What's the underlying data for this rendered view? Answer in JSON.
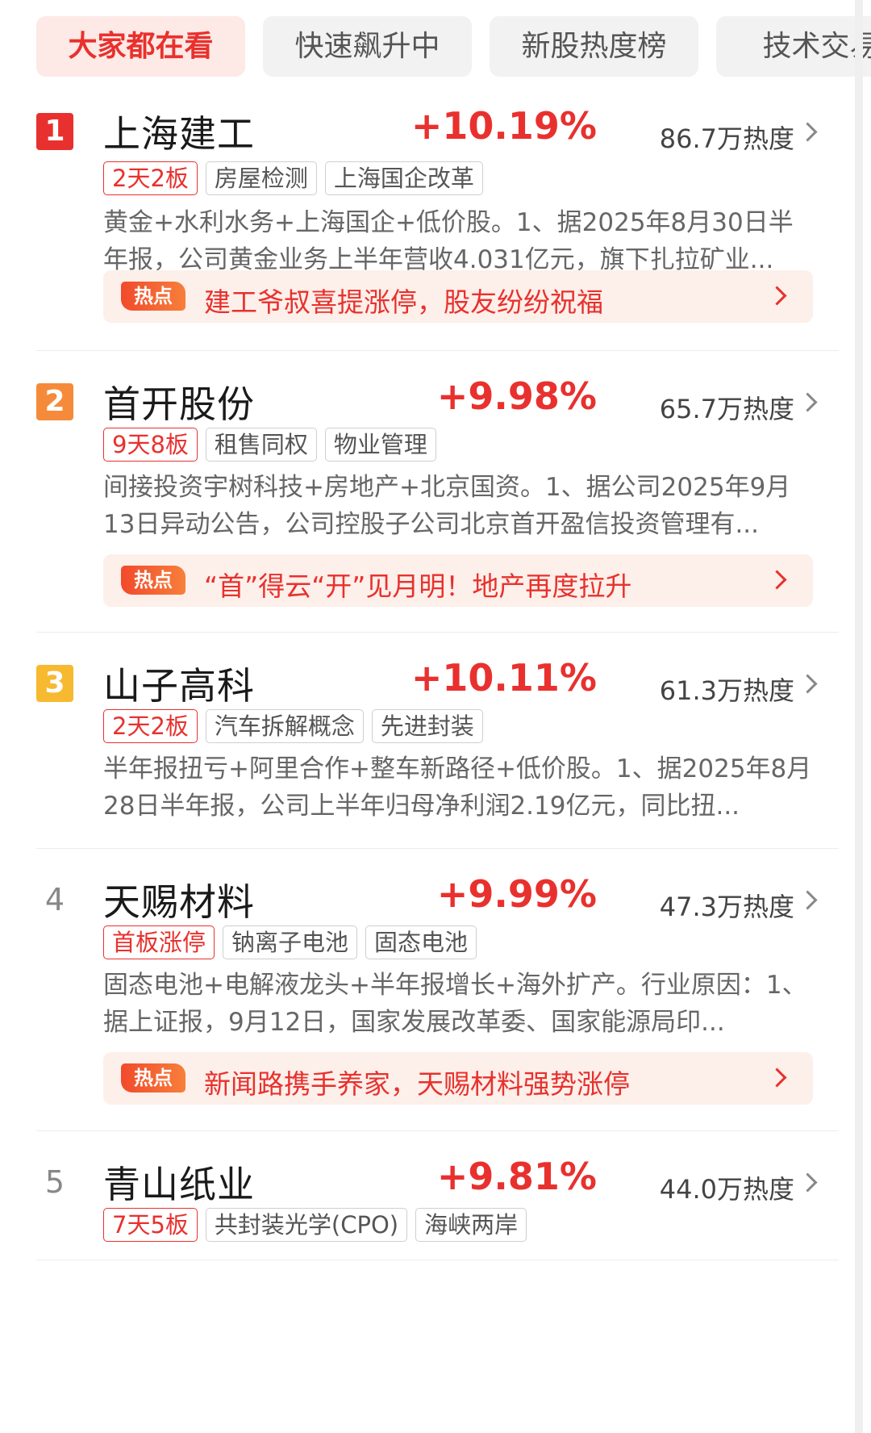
{
  "tabs": [
    {
      "label": "大家都在看",
      "active": true
    },
    {
      "label": "快速飙升中",
      "active": false
    },
    {
      "label": "新股热度榜",
      "active": false
    },
    {
      "label": "技术交易",
      "active": false
    }
  ],
  "colors": {
    "accent": "#e8312e",
    "rank1": "#e8312e",
    "rank2": "#f58b3a",
    "rank3": "#f6b930"
  },
  "stocks": [
    {
      "rank": "1",
      "name": "上海建工",
      "change": "+10.19%",
      "heat": "86.7万热度",
      "tags": [
        "2天2板",
        "房屋检测",
        "上海国企改革"
      ],
      "desc": "黄金+水利水务+上海国企+低价股。1、据2025年8月30日半年报，公司黄金业务上半年营收4.031亿元，旗下扎拉矿业...",
      "hot_label": "热点",
      "hot_text": "建工爷叔喜提涨停，股友纷纷祝福"
    },
    {
      "rank": "2",
      "name": "首开股份",
      "change": "+9.98%",
      "heat": "65.7万热度",
      "tags": [
        "9天8板",
        "租售同权",
        "物业管理"
      ],
      "desc": "间接投资宇树科技+房地产+北京国资。1、据公司2025年9月13日异动公告，公司控股子公司北京首开盈信投资管理有...",
      "hot_label": "热点",
      "hot_text": "“首”得云“开”见月明！地产再度拉升"
    },
    {
      "rank": "3",
      "name": "山子高科",
      "change": "+10.11%",
      "heat": "61.3万热度",
      "tags": [
        "2天2板",
        "汽车拆解概念",
        "先进封装"
      ],
      "desc": "半年报扭亏+阿里合作+整车新路径+低价股。1、据2025年8月28日半年报，公司上半年归母净利润2.19亿元，同比扭..."
    },
    {
      "rank": "4",
      "name": "天赐材料",
      "change": "+9.99%",
      "heat": "47.3万热度",
      "tags": [
        "首板涨停",
        "钠离子电池",
        "固态电池"
      ],
      "desc": "固态电池+电解液龙头+半年报增长+海外扩产。行业原因：1、据上证报，9月12日，国家发展改革委、国家能源局印...",
      "hot_label": "热点",
      "hot_text": "新闻路携手养家，天赐材料强势涨停"
    },
    {
      "rank": "5",
      "name": "青山纸业",
      "change": "+9.81%",
      "heat": "44.0万热度",
      "tags": [
        "7天5板",
        "共封装光学(CPO)",
        "海峡两岸"
      ]
    }
  ]
}
